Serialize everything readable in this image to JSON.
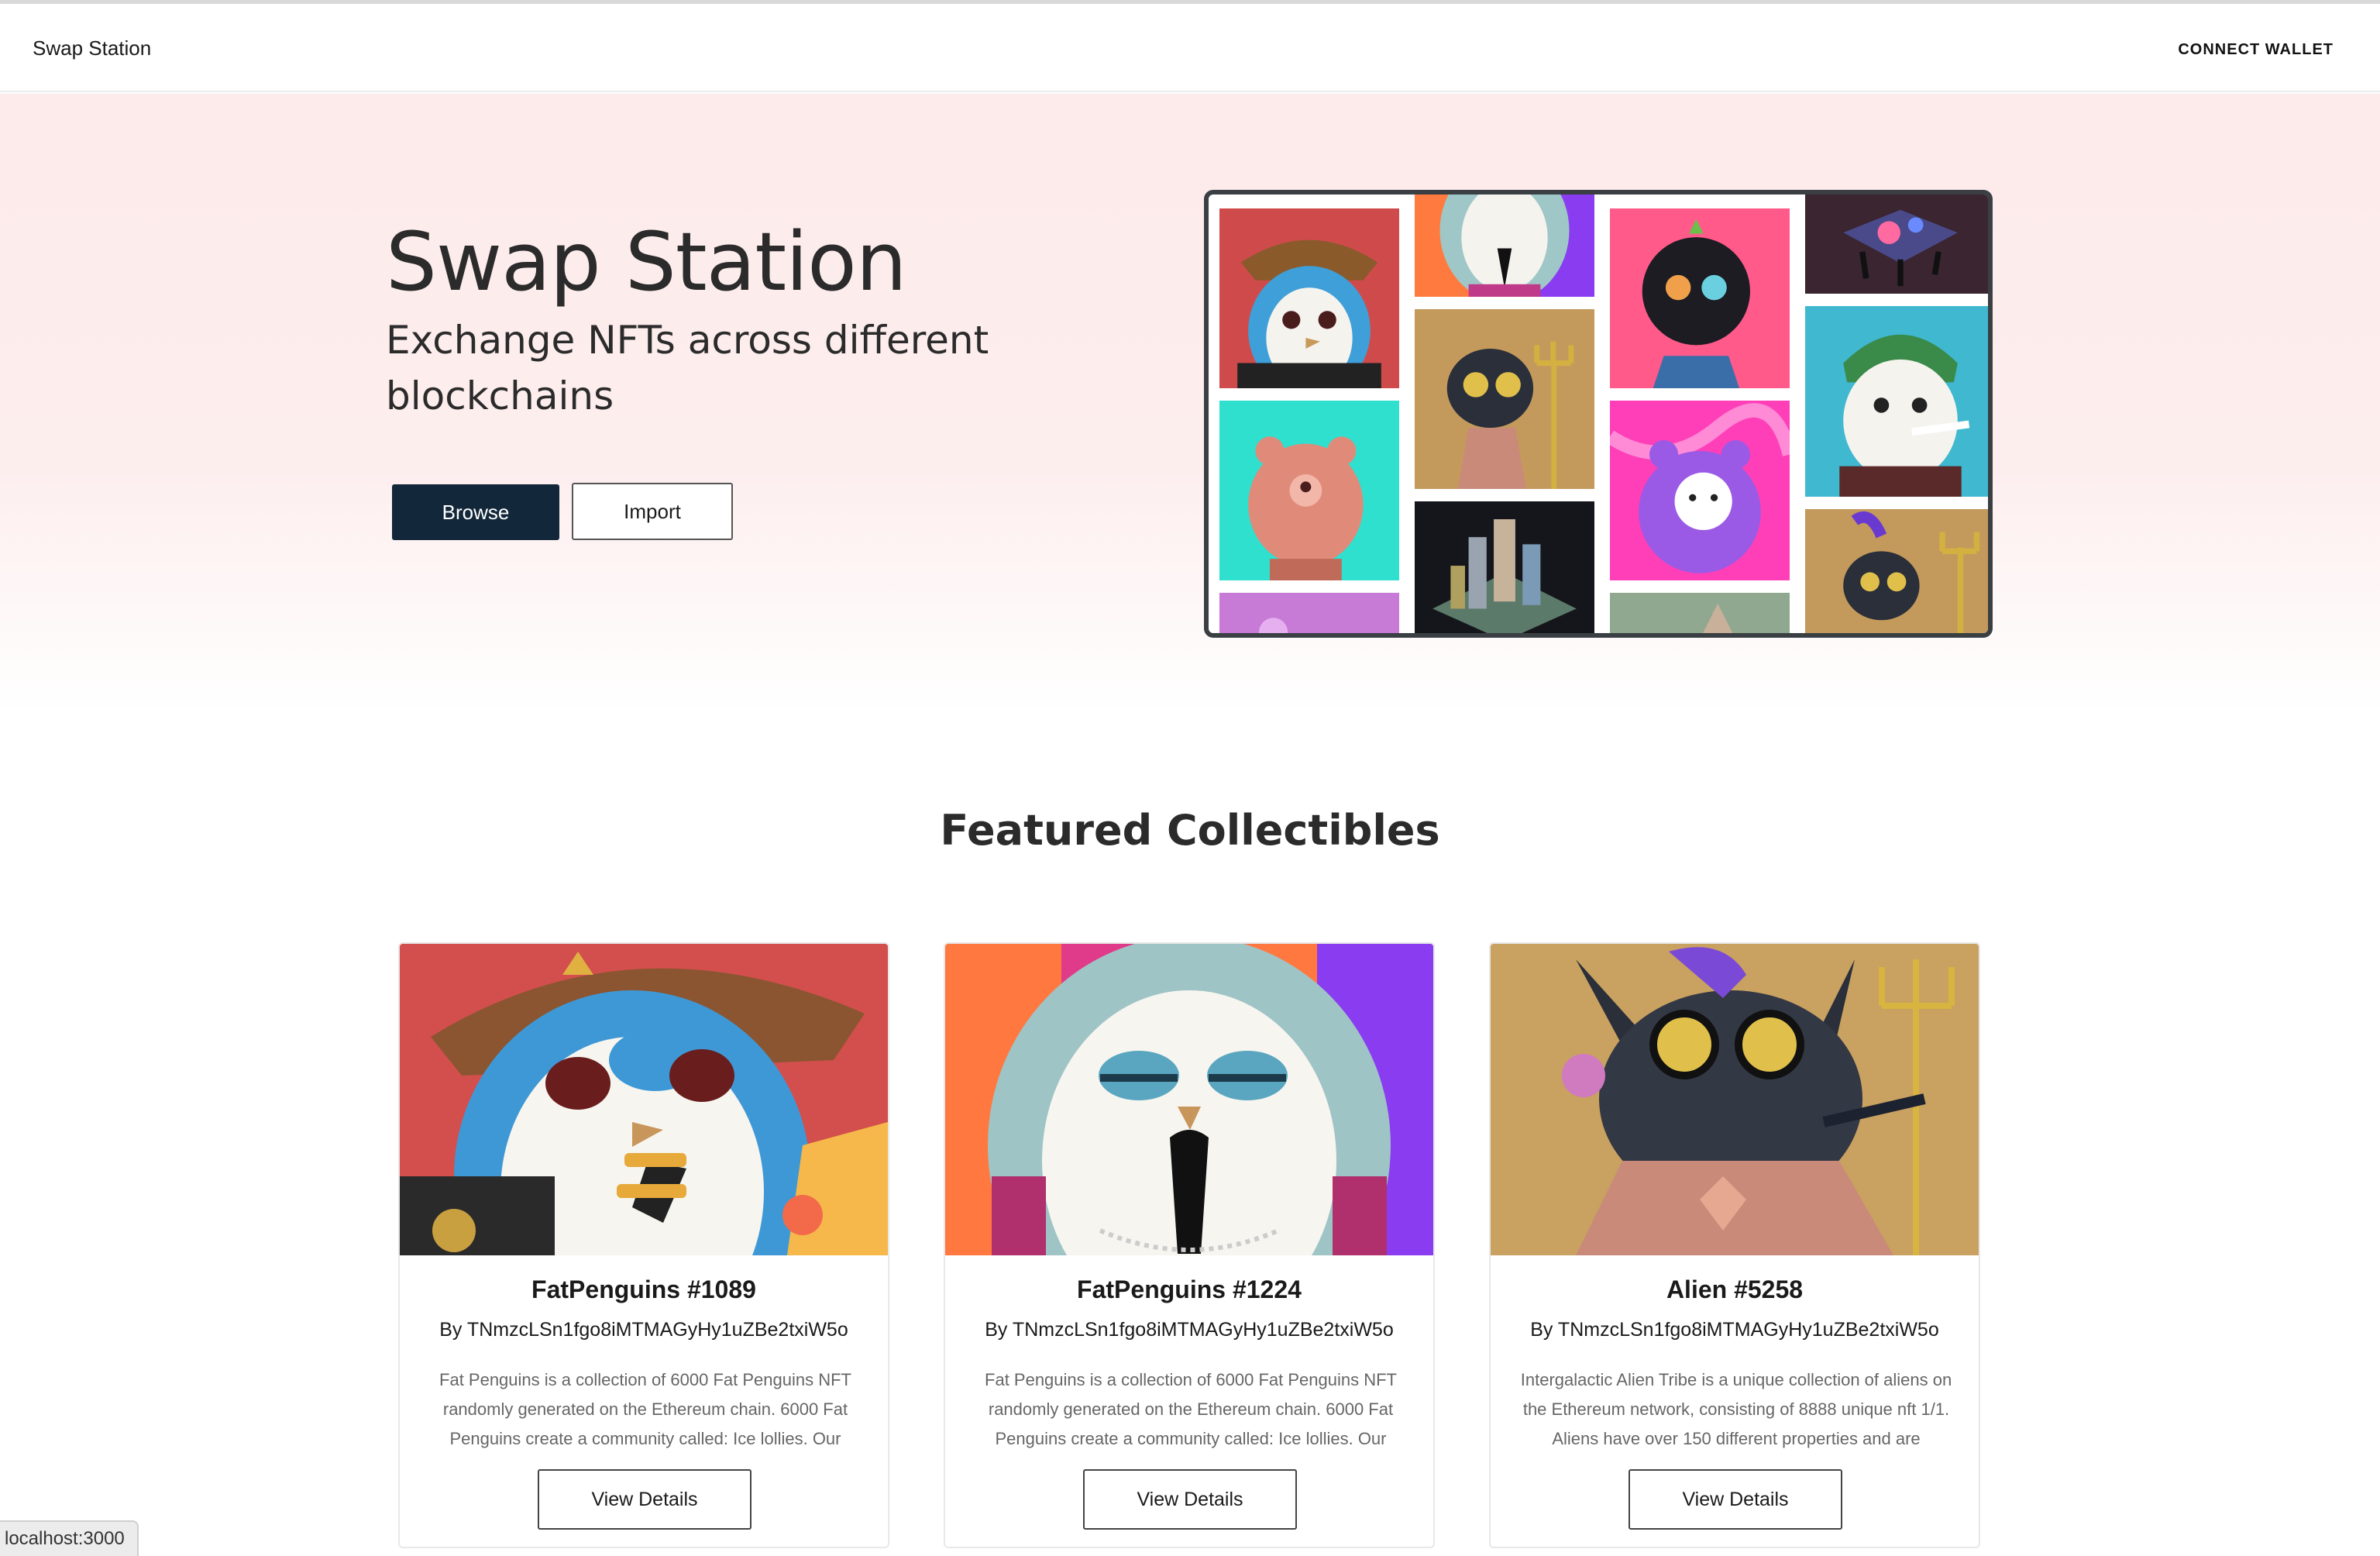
{
  "navbar": {
    "brand": "Swap Station",
    "connect_label": "CONNECT WALLET"
  },
  "hero": {
    "title": "Swap Station",
    "subtitle": "Exchange NFTs across different blockchains",
    "browse_label": "Browse",
    "import_label": "Import"
  },
  "featured": {
    "title": "Featured Collectibles",
    "cards": [
      {
        "title": "FatPenguins #1089",
        "owner": "By TNmzcLSn1fgo8iMTMAGyHy1uZBe2txiW5o",
        "description": "Fat Penguins is a collection of 6000 Fat Penguins NFT randomly generated on the Ethereum chain. 6000 Fat Penguins create a community called: Ice lollies. Our",
        "button": "View Details"
      },
      {
        "title": "FatPenguins #1224",
        "owner": "By TNmzcLSn1fgo8iMTMAGyHy1uZBe2txiW5o",
        "description": "Fat Penguins is a collection of 6000 Fat Penguins NFT randomly generated on the Ethereum chain. 6000 Fat Penguins create a community called: Ice lollies. Our",
        "button": "View Details"
      },
      {
        "title": "Alien #5258",
        "owner": "By TNmzcLSn1fgo8iMTMAGyHy1uZBe2txiW5o",
        "description": "Intergalactic Alien Tribe is a unique collection of aliens on the Ethereum network, consisting of 8888 unique nft 1/1. Aliens have over 150 different properties and are",
        "button": "View Details"
      }
    ]
  },
  "status_bar": {
    "url": "localhost:3000"
  },
  "colors": {
    "primary_button": "#12283a",
    "hero_background": "#fdeaea",
    "mosaic_border": "#3a3f44"
  }
}
